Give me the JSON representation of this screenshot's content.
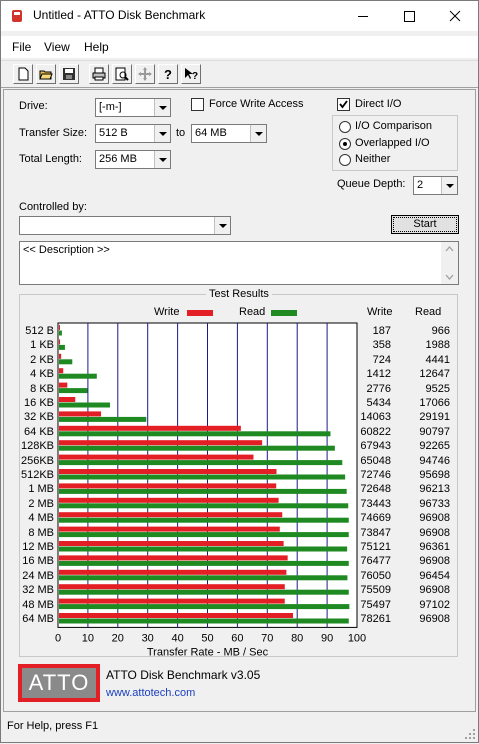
{
  "window": {
    "title": "Untitled - ATTO Disk Benchmark"
  },
  "menu": [
    "File",
    "View",
    "Help"
  ],
  "toolbar": [
    "new-icon",
    "open-icon",
    "save-icon",
    "print-icon",
    "print-preview-icon",
    "move-icon",
    "help-icon",
    "context-help-icon"
  ],
  "form": {
    "drive_label": "Drive:",
    "drive_value": "[-m-]",
    "force_write_label": "Force Write Access",
    "force_write_checked": false,
    "direct_io_label": "Direct I/O",
    "direct_io_checked": true,
    "transfer_size_label": "Transfer Size:",
    "transfer_from": "512 B",
    "to_label": "to",
    "transfer_to": "64 MB",
    "total_length_label": "Total Length:",
    "total_length": "256 MB",
    "io_comparison_label": "I/O Comparison",
    "overlapped_io_label": "Overlapped I/O",
    "neither_label": "Neither",
    "io_mode_selected": "Overlapped I/O",
    "queue_depth_label": "Queue Depth:",
    "queue_depth": "2",
    "controlled_by_label": "Controlled by:",
    "controlled_by_value": "",
    "start_label": "Start",
    "description": "<< Description >>"
  },
  "results": {
    "group_label": "Test Results",
    "legend_write": "Write",
    "legend_read": "Read",
    "col_write": "Write",
    "col_read": "Read",
    "write_color": "#e31e24",
    "read_color": "#1f8a22",
    "rows": [
      {
        "size": "512 B",
        "write": "187",
        "read": "966"
      },
      {
        "size": "1 KB",
        "write": "358",
        "read": "1988"
      },
      {
        "size": "2 KB",
        "write": "724",
        "read": "4441"
      },
      {
        "size": "4 KB",
        "write": "1412",
        "read": "12647"
      },
      {
        "size": "8 KB",
        "write": "2776",
        "read": "9525"
      },
      {
        "size": "16 KB",
        "write": "5434",
        "read": "17066"
      },
      {
        "size": "32 KB",
        "write": "14063",
        "read": "29191"
      },
      {
        "size": "64 KB",
        "write": "60822",
        "read": "90797"
      },
      {
        "size": "128KB",
        "write": "67943",
        "read": "92265"
      },
      {
        "size": "256KB",
        "write": "65048",
        "read": "94746"
      },
      {
        "size": "512KB",
        "write": "72746",
        "read": "95698"
      },
      {
        "size": "1 MB",
        "write": "72648",
        "read": "96213"
      },
      {
        "size": "2 MB",
        "write": "73443",
        "read": "96733"
      },
      {
        "size": "4 MB",
        "write": "74669",
        "read": "96908"
      },
      {
        "size": "8 MB",
        "write": "73847",
        "read": "96908"
      },
      {
        "size": "12 MB",
        "write": "75121",
        "read": "96361"
      },
      {
        "size": "16 MB",
        "write": "76477",
        "read": "96908"
      },
      {
        "size": "24 MB",
        "write": "76050",
        "read": "96454"
      },
      {
        "size": "32 MB",
        "write": "75509",
        "read": "96908"
      },
      {
        "size": "48 MB",
        "write": "75497",
        "read": "97102"
      },
      {
        "size": "64 MB",
        "write": "78261",
        "read": "96908"
      }
    ]
  },
  "chart_data": {
    "type": "bar",
    "orientation": "horizontal",
    "categories": [
      "512 B",
      "1 KB",
      "2 KB",
      "4 KB",
      "8 KB",
      "16 KB",
      "32 KB",
      "64 KB",
      "128KB",
      "256KB",
      "512KB",
      "1 MB",
      "2 MB",
      "4 MB",
      "8 MB",
      "12 MB",
      "16 MB",
      "24 MB",
      "32 MB",
      "48 MB",
      "64 MB"
    ],
    "series": [
      {
        "name": "Write",
        "color": "#e31e24",
        "values": [
          0.187,
          0.358,
          0.724,
          1.412,
          2.776,
          5.434,
          14.063,
          60.822,
          67.943,
          65.048,
          72.746,
          72.648,
          73.443,
          74.669,
          73.847,
          75.121,
          76.477,
          76.05,
          75.509,
          75.497,
          78.261
        ]
      },
      {
        "name": "Read",
        "color": "#1f8a22",
        "values": [
          0.966,
          1.988,
          4.441,
          12.647,
          9.525,
          17.066,
          29.191,
          90.797,
          92.265,
          94.746,
          95.698,
          96.213,
          96.733,
          96.908,
          96.908,
          96.361,
          96.908,
          96.454,
          96.908,
          97.102,
          96.908
        ]
      }
    ],
    "xlabel": "Transfer Rate - MB / Sec",
    "ylabel": "",
    "xlim": [
      0,
      100
    ],
    "xticks": [
      "0",
      "10",
      "20",
      "30",
      "40",
      "50",
      "60",
      "70",
      "80",
      "90",
      "100"
    ],
    "grid": true,
    "legend": "top"
  },
  "footer": {
    "logo_text": "ATTO",
    "product": "ATTO Disk Benchmark v3.05",
    "url": "www.attotech.com"
  },
  "status": "For Help, press F1"
}
